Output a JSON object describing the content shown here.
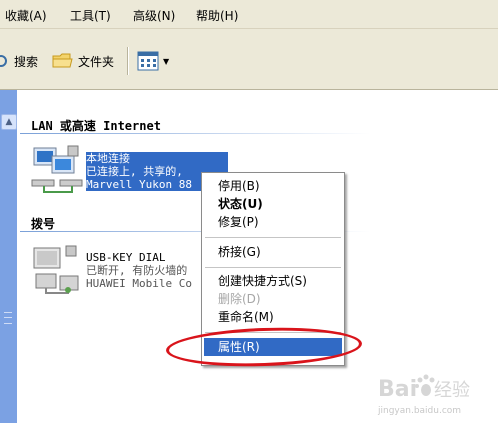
{
  "menubar": {
    "items": [
      "收藏(A)",
      "工具(T)",
      "高级(N)",
      "帮助(H)"
    ]
  },
  "toolbar": {
    "search_label": "搜索",
    "folders_label": "文件夹"
  },
  "groups": {
    "lan_header": "LAN 或高速 Internet",
    "dial_header": "拨号"
  },
  "lan_connection": {
    "name": "本地连接",
    "status": "已连接上, 共享的,",
    "device": "Marvell Yukon 88"
  },
  "dial_connection": {
    "name": "USB-KEY DIAL",
    "status": "已断开, 有防火墙的",
    "device": "HUAWEI Mobile Co"
  },
  "context_menu": {
    "disable": "停用(B)",
    "status": "状态(U)",
    "repair": "修复(P)",
    "bridge": "桥接(G)",
    "create_shortcut": "创建快捷方式(S)",
    "delete": "删除(D)",
    "rename": "重命名(M)",
    "properties": "属性(R)"
  },
  "watermark": {
    "url": "jingyan.baidu.com"
  },
  "colors": {
    "selection": "#316ac5",
    "annotation_red": "#d9141b",
    "left_pane": "#7ba1e3"
  }
}
